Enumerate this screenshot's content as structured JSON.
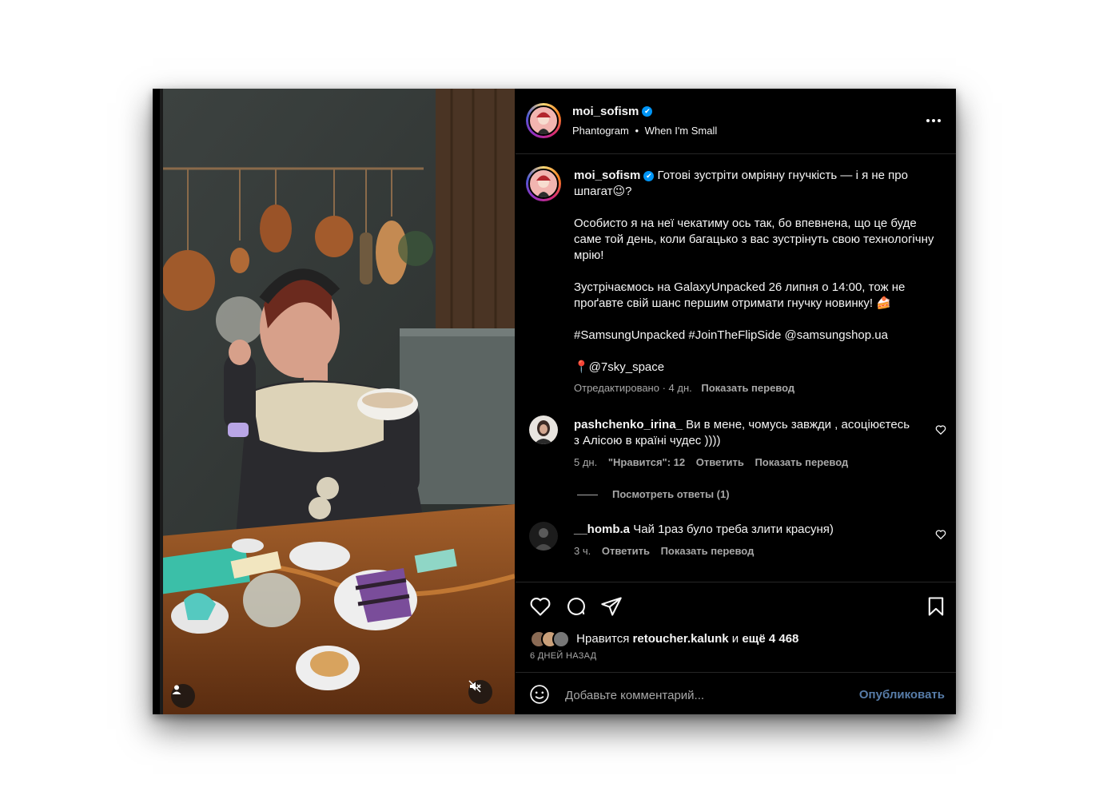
{
  "post": {
    "username": "moi_sofism",
    "verified_mark": "✔",
    "audio_artist": "Phantogram",
    "audio_separator": "•",
    "audio_track": "When I'm Small",
    "more_icon": "more-horizontal-icon"
  },
  "caption": {
    "username": "moi_sofism",
    "p1": "Готові зустріти омріяну гнучкість — і я не про шпагат😉?",
    "p2": "Особисто я на неї чекатиму ось так, бо впевнена, що це буде саме той день, коли багацько з вас зустрінуть свою технологічну мрію!",
    "p3": "Зустрічаємось на GalaxyUnpacked 26 липня о 14:00, тож не проґавте свій шанс першим отримати гнучку новинку! 🍰",
    "p4": "#SamsungUnpacked #JoinTheFlipSide @samsungshop.ua",
    "p5": "📍@7sky_space",
    "meta_edited": "Отредактировано · 4 дн.",
    "meta_translate": "Показать перевод"
  },
  "comments": [
    {
      "username": "pashchenko_irina_",
      "text": "Ви в мене, чомусь завжди , асоціюєтесь з Алісою в країні чудес ))))",
      "time": "5 дн.",
      "likes": "\"Нравится\": 12",
      "reply": "Ответить",
      "translate": "Показать перевод",
      "view_replies": "Посмотреть ответы (1)"
    },
    {
      "username": "__homb.a",
      "text": "Чай 1раз було треба злити красуня)",
      "time": "3 ч.",
      "reply": "Ответить",
      "translate": "Показать перевод"
    }
  ],
  "likes": {
    "prefix": "Нравится",
    "user": "retoucher.kalunk",
    "middle": "и",
    "rest": "ещё 4 468",
    "date": "6 ДНЕЙ НАЗАД"
  },
  "comment_box": {
    "placeholder": "Добавьте комментарий...",
    "publish": "Опубликовать"
  },
  "colors": {
    "background": "#000000",
    "text": "#f5f5f5",
    "muted": "#a8a8a8",
    "publish": "#577ca8",
    "verified": "#0095f6"
  }
}
